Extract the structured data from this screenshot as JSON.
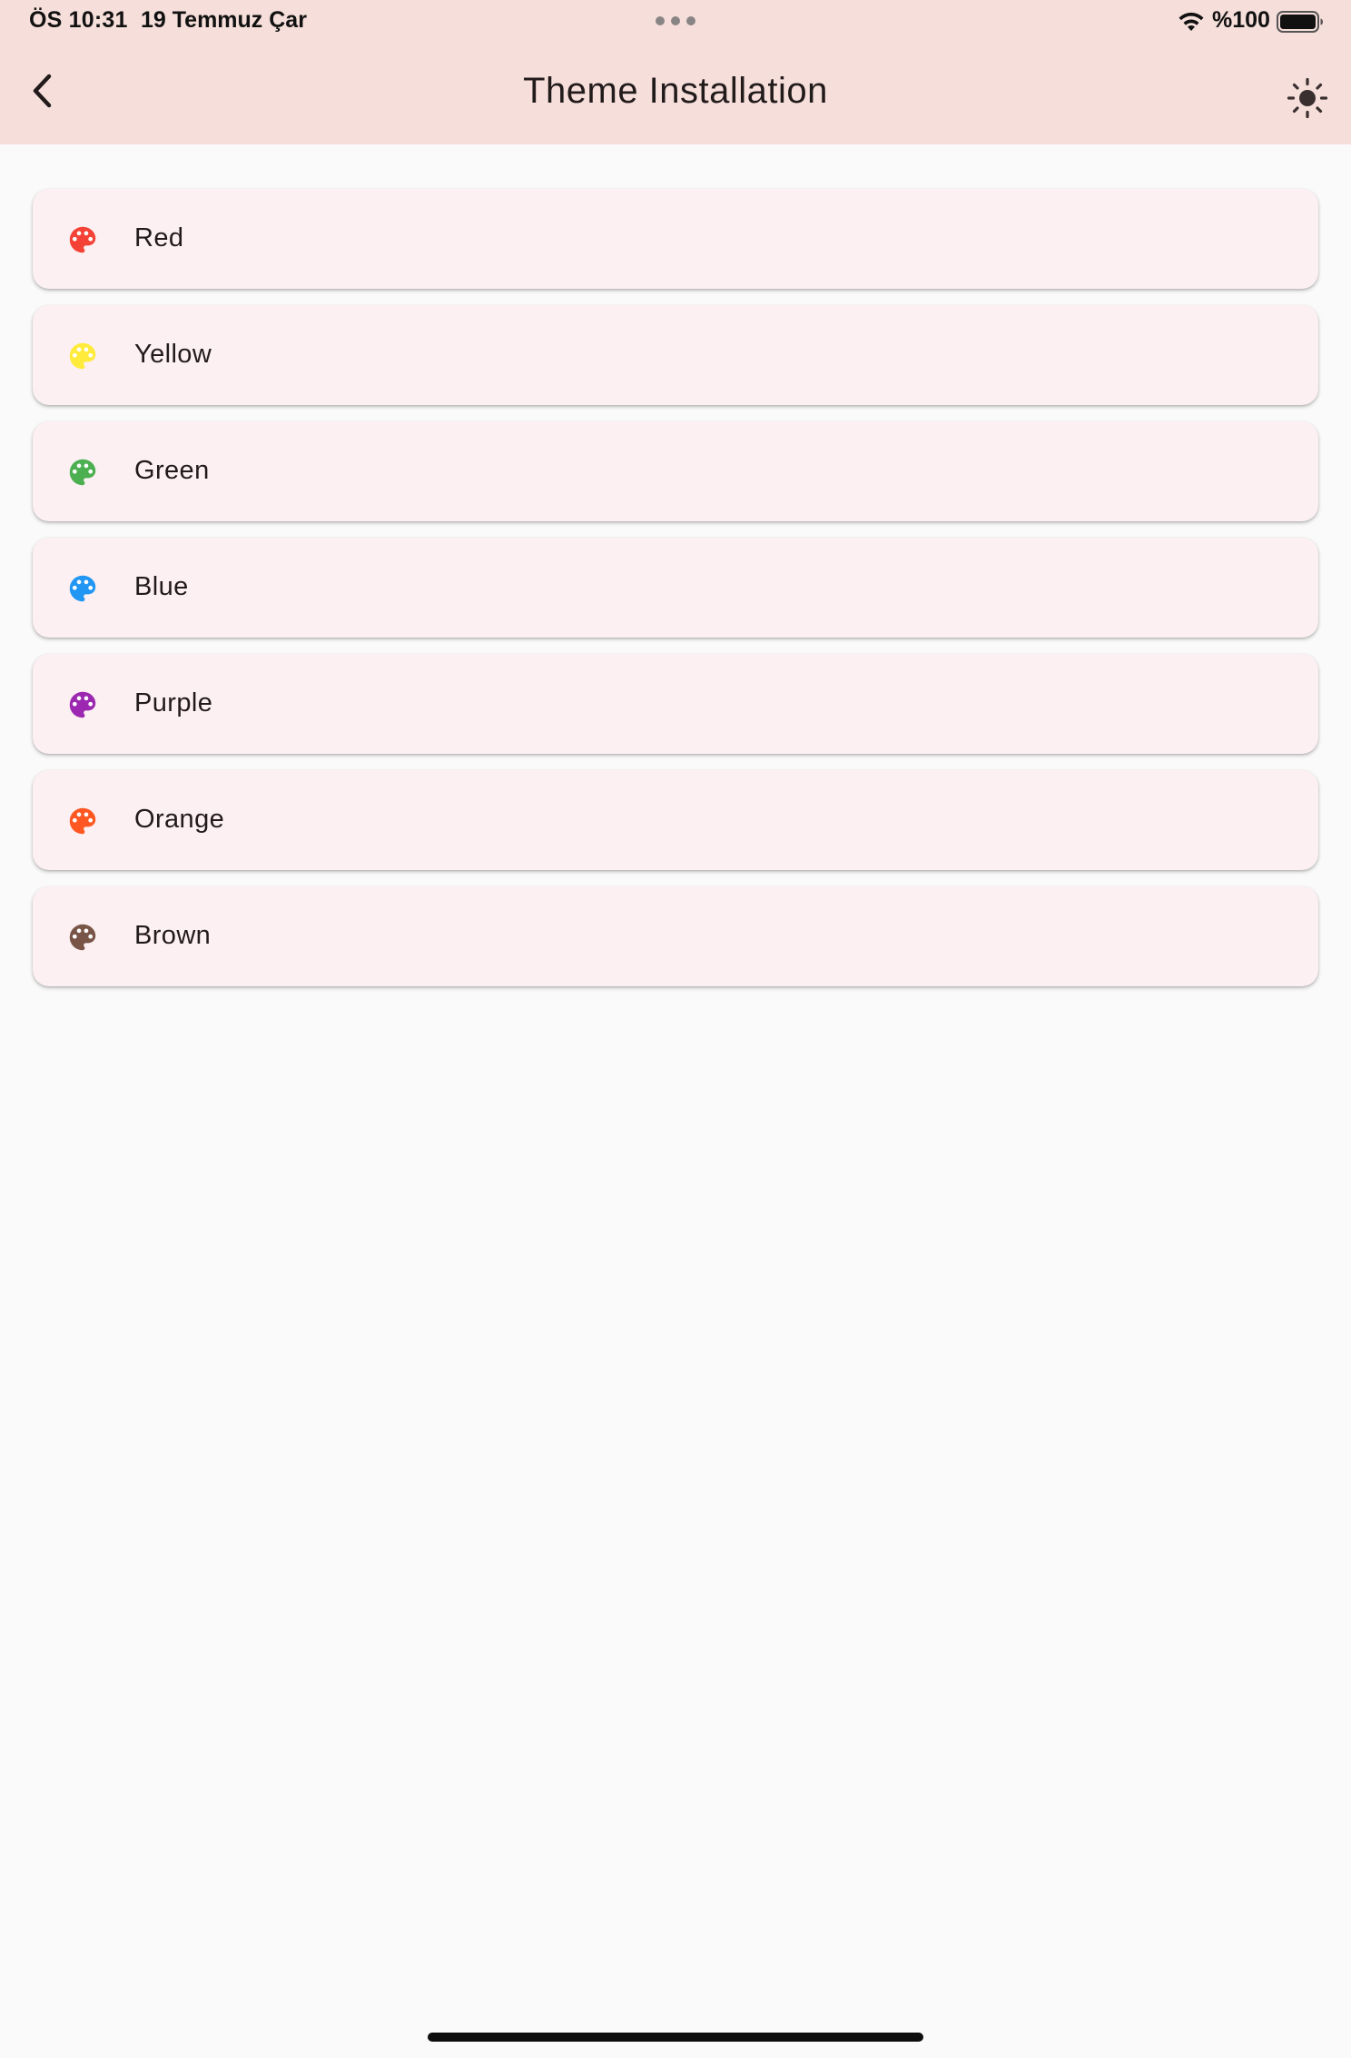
{
  "status_bar": {
    "time": "ÖS 10:31",
    "date": "19 Temmuz Çar",
    "battery": "%100",
    "icons": [
      "wifi-icon",
      "battery-icon"
    ]
  },
  "app_bar": {
    "title": "Theme Installation",
    "back_icon": "chevron-left-icon",
    "action_icon": "brightness-icon"
  },
  "colors": {
    "header_bg": "#f6dfdb",
    "page_bg": "#fafafa",
    "card_bg": "#fcf0f2"
  },
  "themes": [
    {
      "label": "Red",
      "color": "#f44336",
      "icon": "palette-icon"
    },
    {
      "label": "Yellow",
      "color": "#ffeb3b",
      "icon": "palette-icon"
    },
    {
      "label": "Green",
      "color": "#4caf50",
      "icon": "palette-icon"
    },
    {
      "label": "Blue",
      "color": "#2196f3",
      "icon": "palette-icon"
    },
    {
      "label": "Purple",
      "color": "#9c27b0",
      "icon": "palette-icon"
    },
    {
      "label": "Orange",
      "color": "#ff5722",
      "icon": "palette-icon"
    },
    {
      "label": "Brown",
      "color": "#795548",
      "icon": "palette-icon"
    }
  ]
}
